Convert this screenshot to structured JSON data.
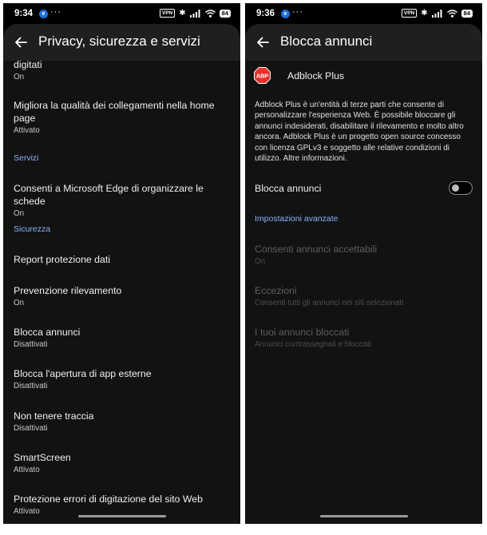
{
  "left": {
    "status": {
      "time": "9:34",
      "badge": "e",
      "dots": "···",
      "vpn": "VPN",
      "battery": "84"
    },
    "title": "Privacy, sicurezza e servizi",
    "items": [
      {
        "title": "digitati",
        "sub": "On"
      },
      {
        "title": "Migliora la qualità dei collegamenti nella home page",
        "sub": "Attivato"
      },
      {
        "title": "Consenti a Microsoft Edge di organizzare le schede",
        "sub": "On"
      },
      {
        "title": "Report protezione dati",
        "sub": ""
      },
      {
        "title": "Prevenzione rilevamento",
        "sub": "On"
      },
      {
        "title": "Blocca annunci",
        "sub": "Disattivati"
      },
      {
        "title": "Blocca l'apertura di app esterne",
        "sub": "Disattivati"
      },
      {
        "title": "Non tenere traccia",
        "sub": "Disattivati"
      },
      {
        "title": "SmartScreen",
        "sub": "Attivato"
      },
      {
        "title": "Protezione errori di digitazione del sito Web",
        "sub": "Attivato"
      }
    ],
    "sections": {
      "services": "Servizi",
      "security": "Sicurezza"
    }
  },
  "right": {
    "status": {
      "time": "9:36",
      "badge": "e",
      "dots": "···",
      "vpn": "VPN",
      "battery": "84"
    },
    "title": "Blocca annunci",
    "provider": "Adblock Plus",
    "logo_text": "ABP",
    "description": "Adblock Plus è un'entità di terze parti che consente di personalizzare l'esperienza Web. È possibile bloccare gli annunci indesiderati, disabilitare il rilevamento e molto altro ancora. Adblock Plus è un progetto open source concesso con licenza GPLv3 e soggetto alle relative condizioni di utilizzo. Altre informazioni.",
    "toggle": {
      "label": "Blocca annunci",
      "on": false
    },
    "advanced_header": "Impostazioni avanzate",
    "advanced": [
      {
        "title": "Consenti annunci accettabili",
        "sub": "On"
      },
      {
        "title": "Eccezioni",
        "sub": "Consenti tutti gli annunci nei siti selezionati"
      },
      {
        "title": "I tuoi annunci bloccati",
        "sub": "Annunci contrassegnati e bloccati"
      }
    ]
  },
  "colors": {
    "accent": "#8ab4f8",
    "logo_red": "#e4322b",
    "appbar": "#1f1f1f",
    "background": "#121212"
  }
}
